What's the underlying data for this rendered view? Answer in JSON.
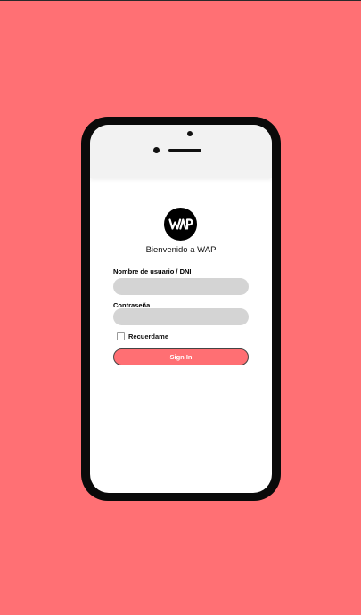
{
  "colors": {
    "background": "#ff7074",
    "phone_frame": "#0a0a0a",
    "screen": "#ffffff",
    "input_fill": "#d4d4d4",
    "button_fill": "#ff6f73"
  },
  "logo": {
    "text": "WAP",
    "icon": "wap-logo-icon"
  },
  "welcome_text": "Bienvenido a WAP",
  "form": {
    "username_label": "Nombre de usuario / DNI",
    "username_value": "",
    "password_label": "Contraseña",
    "password_value": "",
    "remember_label": "Recuerdame",
    "remember_checked": false,
    "submit_label": "Sign In"
  }
}
